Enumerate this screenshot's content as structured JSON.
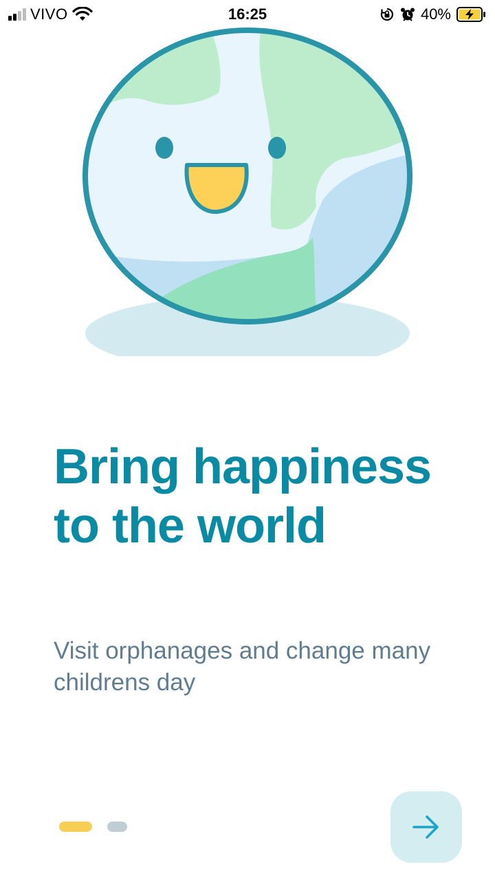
{
  "status_bar": {
    "carrier": "VIVO",
    "time": "16:25",
    "battery_percent": "40%",
    "icons": [
      "signal-icon",
      "wifi-icon",
      "orientation-lock-icon",
      "alarm-icon",
      "battery-charging-icon"
    ]
  },
  "onboarding": {
    "headline": "Bring happiness to the world",
    "subtitle": "Visit orphanages and change many childrens day",
    "current_page": 1,
    "total_pages": 2,
    "next_icon": "arrow-right-icon"
  },
  "colors": {
    "headline": "#0b8aa3",
    "subtitle": "#607d8f",
    "active_dot": "#f8cf55",
    "inactive_dot": "#bfcdd4",
    "button_bg": "#d3edf1",
    "arrow": "#1aa6c8"
  }
}
